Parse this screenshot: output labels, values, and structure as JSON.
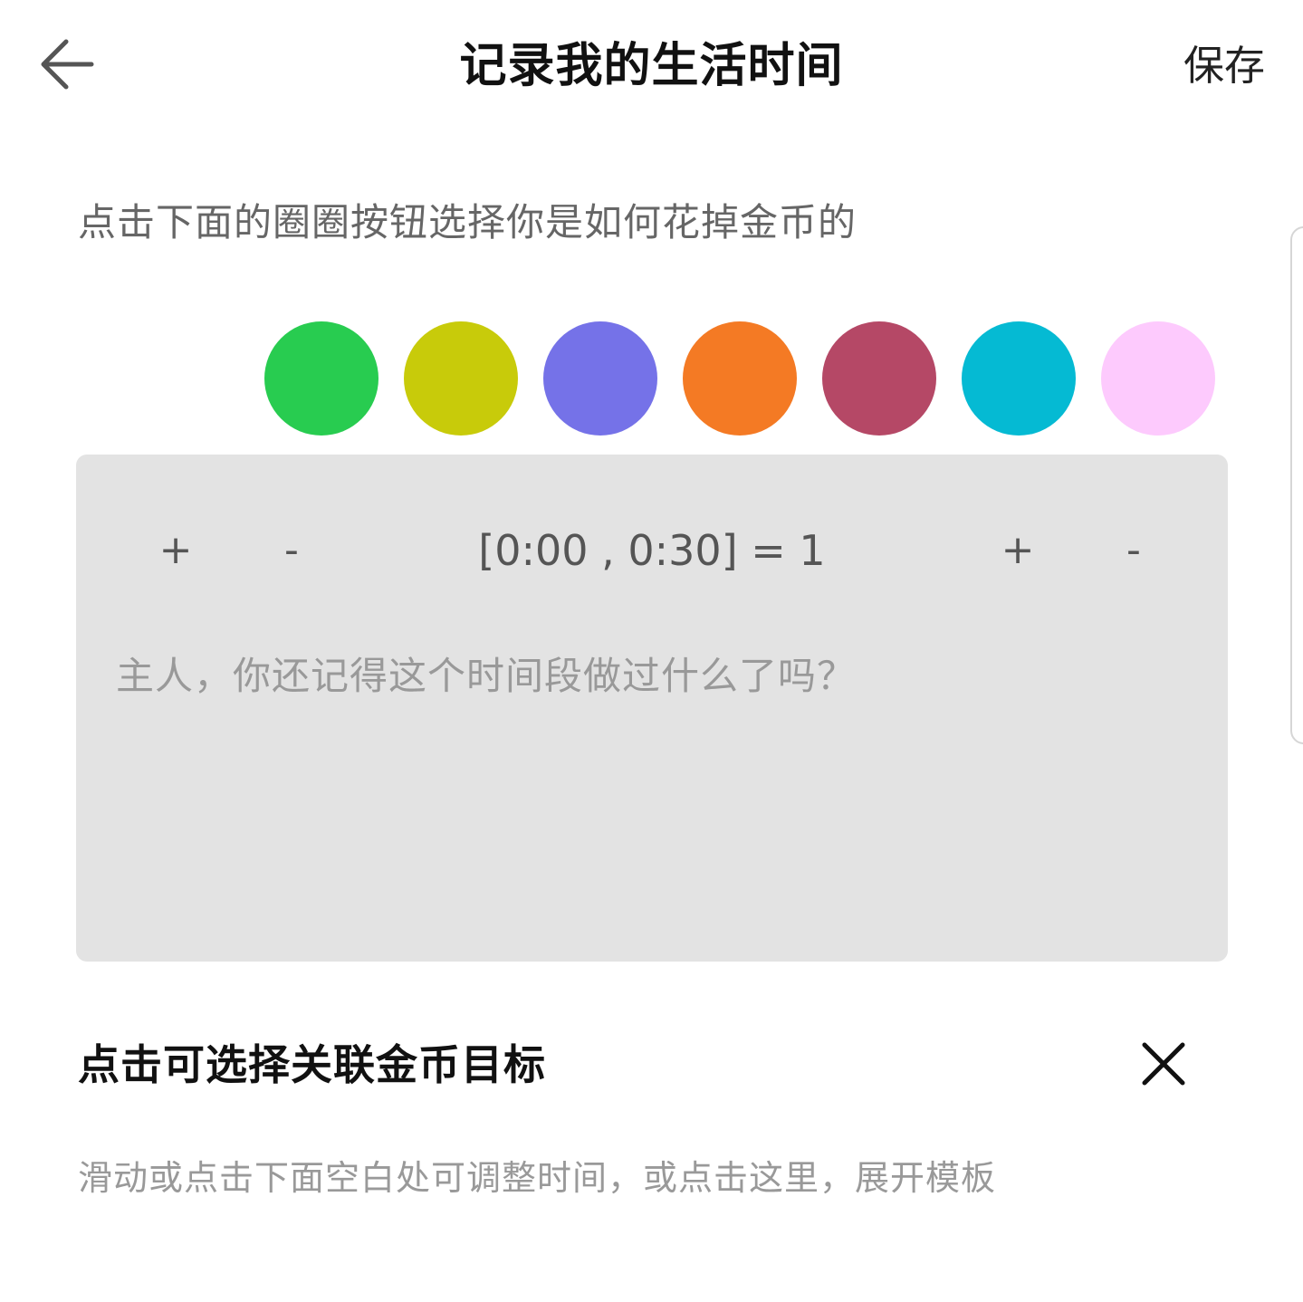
{
  "header": {
    "title": "记录我的生活时间",
    "save_label": "保存",
    "back_icon": "arrow-left-icon"
  },
  "instruction": "点击下面的圈圈按钮选择你是如何花掉金币的",
  "color_circles": [
    {
      "color": "#28cc50"
    },
    {
      "color": "#c8cb0a"
    },
    {
      "color": "#7572e8"
    },
    {
      "color": "#f47a24"
    },
    {
      "color": "#b54866"
    },
    {
      "color": "#05bad3"
    },
    {
      "color": "#fdcafd"
    }
  ],
  "time_card": {
    "start_plus": "+",
    "start_minus": "-",
    "range_text": "[0:00 , 0:30] = 1",
    "end_plus": "+",
    "end_minus": "-",
    "note_placeholder": "主人，你还记得这个时间段做过什么了吗？"
  },
  "goal": {
    "label": "点击可选择关联金币目标",
    "close_icon": "close-icon"
  },
  "hint": "滑动或点击下面空白处可调整时间，或点击这里，展开模板"
}
